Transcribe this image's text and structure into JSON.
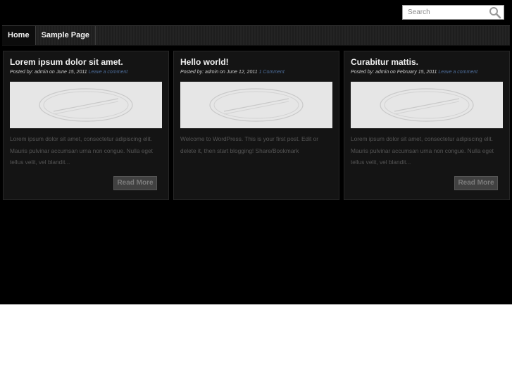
{
  "search": {
    "placeholder": "Search"
  },
  "nav": {
    "items": [
      "Home",
      "Sample Page"
    ]
  },
  "posts": [
    {
      "title": "Lorem ipsum dolor sit amet.",
      "meta_prefix": "Posted by: admin on June 15, 2011",
      "meta_link": "Leave a comment",
      "excerpt": "Lorem ipsum dolor sit amet, consectetur adipiscing elit. Mauris pulvinar accumsan urna non congue. Nulla eget tellus velit, vel blandit...",
      "button": "Read More"
    },
    {
      "title": "Hello world!",
      "meta_prefix": "Posted by: admin on June 12, 2011",
      "meta_link": "1 Comment",
      "excerpt": "Welcome to WordPress. This is your first post. Edit or delete it, then start blogging! Share/Bookmark",
      "button": ""
    },
    {
      "title": "Curabitur mattis.",
      "meta_prefix": "Posted by: admin on February 15, 2011",
      "meta_link": "Leave a comment",
      "excerpt": "Lorem ipsum dolor sit amet, consectetur adipiscing elit. Mauris pulvinar accumsan urna non congue. Nulla eget tellus velit, vel blandit...",
      "button": "Read More"
    }
  ],
  "colors": {
    "background": "#000000",
    "card": "#141414",
    "link": "#4d6d9a"
  }
}
